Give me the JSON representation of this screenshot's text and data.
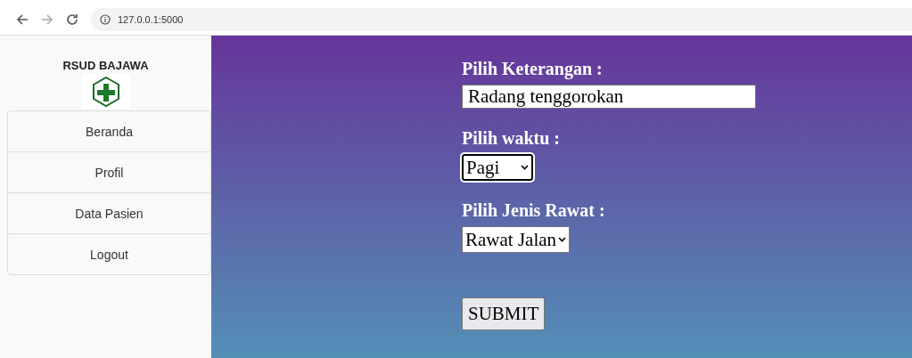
{
  "browser": {
    "url": "127.0.0.1:5000"
  },
  "sidebar": {
    "title": "RSUD BAJAWA",
    "items": [
      {
        "label": "Beranda"
      },
      {
        "label": "Profil"
      },
      {
        "label": "Data Pasien"
      },
      {
        "label": "Logout"
      }
    ]
  },
  "form": {
    "fields": [
      {
        "kind": "text",
        "label": "Pilih Keterangan :",
        "value": "Radang tenggorokan"
      },
      {
        "kind": "select",
        "label": "Pilih waktu :",
        "value": "Pagi",
        "focused": true
      },
      {
        "kind": "select",
        "label": "Pilih Jenis Rawat :",
        "value": "Rawat Jalan",
        "focused": false
      }
    ],
    "submit": "SUBMIT"
  }
}
